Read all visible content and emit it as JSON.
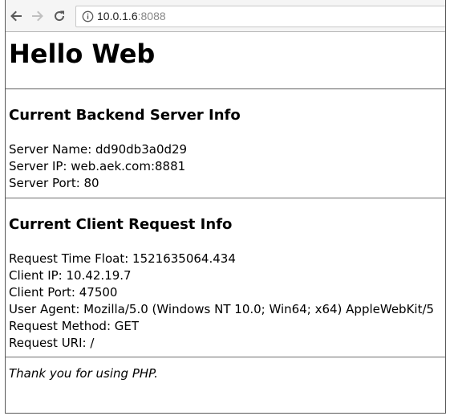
{
  "browser": {
    "url_host": "10.0.1.6",
    "url_port": ":8088"
  },
  "page": {
    "heading": "Hello Web",
    "server_section": {
      "title": "Current Backend Server Info",
      "lines": [
        "Server Name: dd90db3a0d29",
        "Server IP: web.aek.com:8881",
        "Server Port: 80"
      ]
    },
    "client_section": {
      "title": "Current Client Request Info",
      "lines": [
        "Request Time Float: 1521635064.434",
        "Client IP: 10.42.19.7",
        "Client Port: 47500",
        "User Agent: Mozilla/5.0 (Windows NT 10.0; Win64; x64) AppleWebKit/5",
        "Request Method: GET",
        "Request URI: /"
      ]
    },
    "footer": "Thank you for using PHP."
  }
}
